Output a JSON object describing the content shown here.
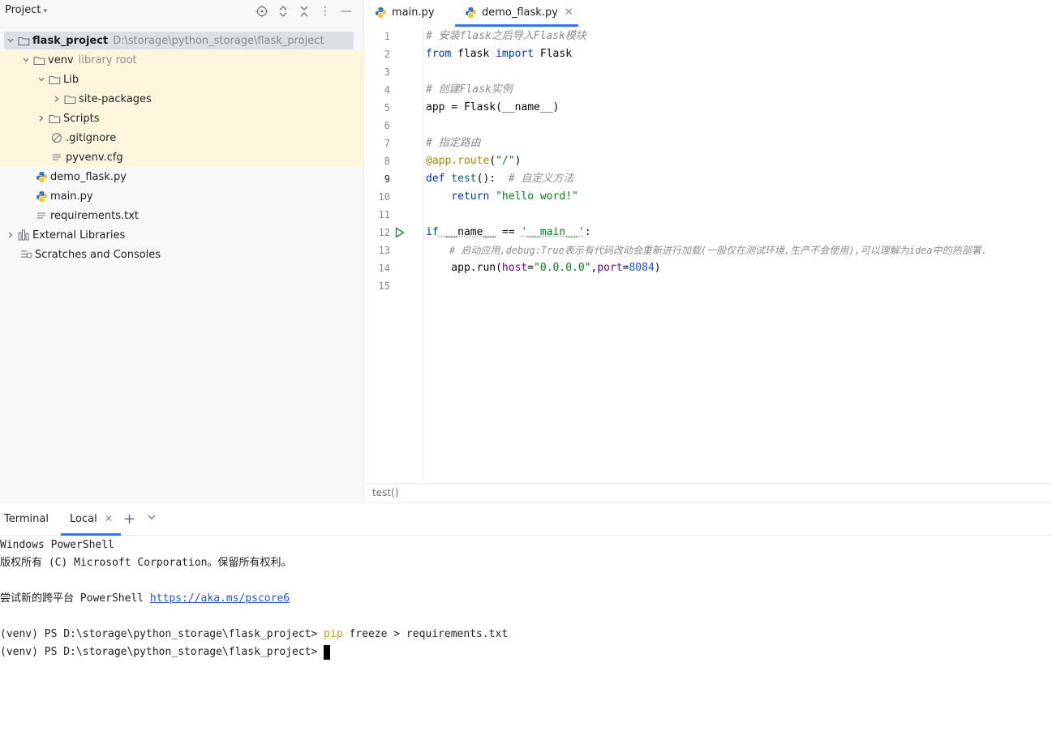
{
  "project": {
    "title": "Project",
    "tree": [
      {
        "name": "flask_project",
        "hint": "D:\\storage\\python_storage\\flask_project"
      },
      {
        "name": "venv",
        "hint": "library root"
      },
      {
        "name": "Lib"
      },
      {
        "name": "site-packages"
      },
      {
        "name": "Scripts"
      },
      {
        "name": ".gitignore"
      },
      {
        "name": "pyvenv.cfg"
      },
      {
        "name": "demo_flask.py"
      },
      {
        "name": "main.py"
      },
      {
        "name": "requirements.txt"
      },
      {
        "name": "External Libraries"
      },
      {
        "name": "Scratches and Consoles"
      }
    ]
  },
  "editor": {
    "tabs": [
      {
        "label": "main.py"
      },
      {
        "label": "demo_flask.py"
      }
    ],
    "line_numbers": [
      "1",
      "2",
      "3",
      "4",
      "5",
      "6",
      "7",
      "8",
      "9",
      "10",
      "11",
      "12",
      "13",
      "14",
      "15"
    ],
    "breadcrumb": "test()",
    "code": {
      "l1": "# 安装flask之后导入Flask模块",
      "l2_from": "from",
      "l2_mod": " flask ",
      "l2_import": "import",
      "l2_name": " Flask",
      "l4": "# 创建Flask实例",
      "l5": "app = Flask(__name__)",
      "l7": "# 指定路由",
      "l8_dec": "@app.route",
      "l8_open": "(",
      "l8_str": "\"/\"",
      "l8_close": ")",
      "l9_def": "def",
      "l9_fn": " test",
      "l9_rest": "():  ",
      "l9_com": "# 自定义方法",
      "l10_indent": "    ",
      "l10_kw": "return",
      "l10_sp": " ",
      "l10_str": "\"hello word!\"",
      "l12_if": "if",
      "l12_name": " __name__",
      "l12_eq": " == ",
      "l12_str": "'__main__'",
      "l12_colon": ":",
      "l13": "    # 启动应用,debug:True表示有代码改动会重新进行加载(一般仅在测试环境,生产不会使用),可以理解为idea中的热部署.",
      "l14_a": "    app.run(",
      "l14_p1": "host",
      "l14_eq1": "=",
      "l14_s1": "\"0.0.0.0\"",
      "l14_comma": ",",
      "l14_p2": "port",
      "l14_eq2": "=",
      "l14_n": "8084",
      "l14_close": ")"
    }
  },
  "terminal": {
    "title": "Terminal",
    "tab": "Local",
    "lines": {
      "t1": "Windows PowerShell",
      "t2": "版权所有 (C) Microsoft Corporation。保留所有权利。",
      "t3_a": "尝试新的跨平台 PowerShell ",
      "t3_link": "https://aka.ms/pscore6",
      "t4_prompt": "(venv) PS D:\\storage\\python_storage\\flask_project> ",
      "t4_cmd": "pip",
      "t4_rest": " freeze > requirements.txt",
      "t5_prompt": "(venv) PS D:\\storage\\python_storage\\flask_project> "
    }
  },
  "colors": {
    "accent": "#3574f0",
    "highlight_row": "#fdf6dc",
    "selected_row": "#dcdfe4"
  }
}
